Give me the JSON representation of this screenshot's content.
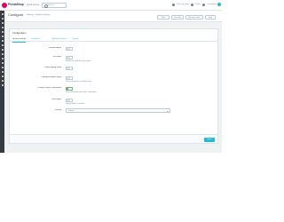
{
  "brand": {
    "name": "PrestaShop"
  },
  "topbar": {
    "quick_access": "Quick Access",
    "search_placeholder": "Search",
    "links": [
      "View my shop",
      "Orders",
      "Customers"
    ]
  },
  "header": {
    "title": "Configure",
    "breadcrumb": "Modules > Module Settings",
    "buttons": [
      "Back",
      "Translate",
      "Manage hooks",
      "Help"
    ]
  },
  "panel": {
    "heading": "Configuration",
    "tabs": [
      "General settings",
      "Information",
      "Advanced options",
      "Support"
    ],
    "rows": [
      {
        "label": "Enable module",
        "type": "switch",
        "state": "off",
        "help": ""
      },
      {
        "label": "Live mode",
        "type": "switch",
        "state": "off",
        "help": "Enable live mode for transactions"
      },
      {
        "label": "Enable debug mode",
        "type": "switch",
        "state": "off",
        "help": ""
      },
      {
        "label": "Display on product page",
        "type": "switch",
        "state": "off",
        "help": "Show information on product page"
      },
      {
        "label": "Display in order confirmation",
        "type": "switch",
        "state": "on",
        "help": "Show information after order confirmation"
      },
      {
        "label": "Show logos",
        "type": "switch",
        "state": "off",
        "help": "Display logos in checkout"
      },
      {
        "label": "Position",
        "type": "select",
        "value": "Default",
        "help": ""
      }
    ],
    "save_label": "Save"
  },
  "colors": {
    "accent": "#25b9d7",
    "brand": "#df0067",
    "sidebar": "#363a41",
    "switch_on": "#70b580"
  }
}
